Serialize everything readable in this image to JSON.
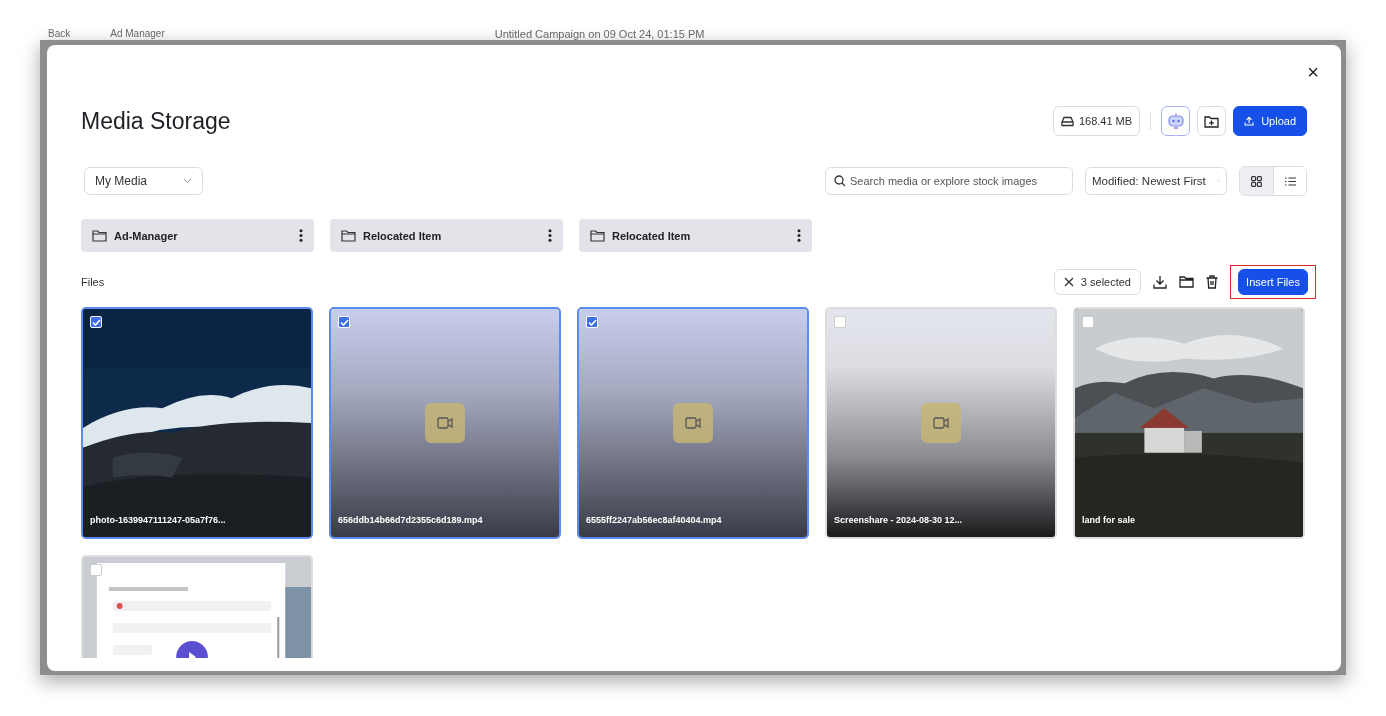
{
  "backdrop": {
    "back_label": "Back",
    "app_label": "Ad Manager",
    "campaign_title": "Untitled Campaign on 09 Oct 24, 01:15 PM"
  },
  "modal": {
    "title": "Media Storage",
    "close": "×"
  },
  "storage": {
    "used": "168.41 MB"
  },
  "upload_label": "Upload",
  "source_dropdown": {
    "value": "My Media"
  },
  "search": {
    "placeholder": "Search media or explore stock images"
  },
  "sort_dropdown": {
    "value": "Modified: Newest First"
  },
  "view_toggle": [
    {
      "kind": "grid",
      "selected": true
    },
    {
      "kind": "list",
      "selected": false
    }
  ],
  "folders": [
    {
      "name": "Ad-Manager"
    },
    {
      "name": "Relocated Item"
    },
    {
      "name": "Relocated Item"
    }
  ],
  "files_label": "Files",
  "selection": {
    "count_label": "3 selected"
  },
  "insert_label": "Insert Files",
  "files": [
    {
      "name": "photo-1639947111247-05a7f76...",
      "selected": true
    },
    {
      "name": "656ddb14b66d7d2355c6d189.mp4",
      "kind": "video",
      "selected": true
    },
    {
      "name": "6555ff2247ab56ec8af40404.mp4",
      "kind": "video",
      "selected": true
    },
    {
      "name": "Screenshare - 2024-08-30 12...",
      "kind": "video",
      "selected": false
    },
    {
      "name": "land for sale",
      "selected": false
    },
    {
      "kind": "video_preview",
      "selected": false
    }
  ]
}
